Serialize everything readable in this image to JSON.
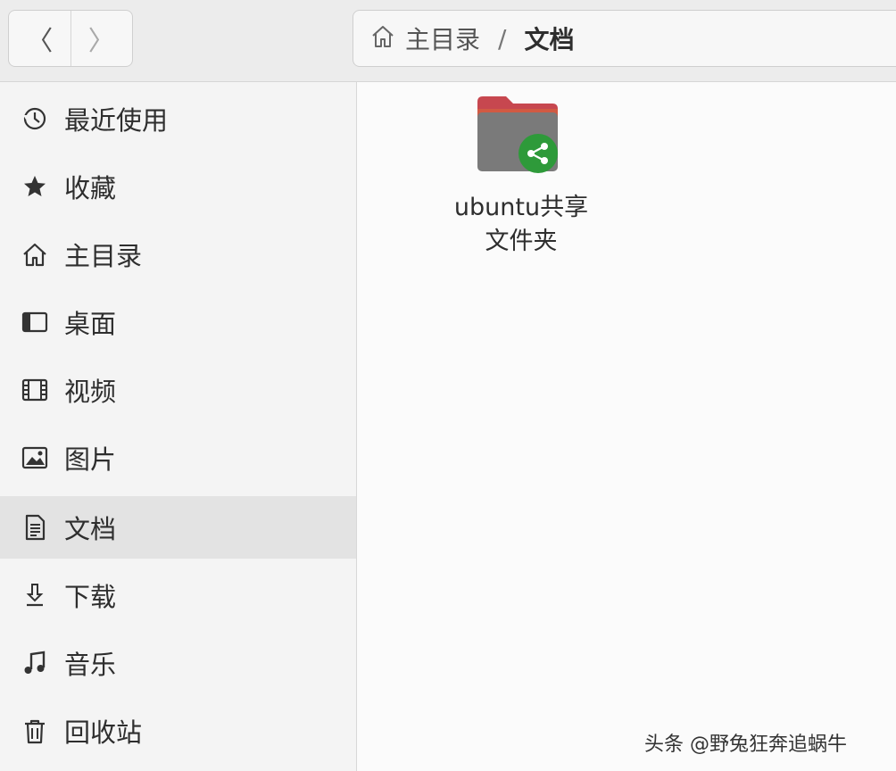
{
  "header": {
    "back_glyph": "〈",
    "forward_glyph": "〉",
    "path": {
      "home": "主目录",
      "separator": "/",
      "current": "文档"
    }
  },
  "sidebar": {
    "items": [
      {
        "label": "最近使用",
        "icon": "recent-icon",
        "active": false
      },
      {
        "label": "收藏",
        "icon": "star-icon",
        "active": false
      },
      {
        "label": "主目录",
        "icon": "home-icon",
        "active": false
      },
      {
        "label": "桌面",
        "icon": "desktop-icon",
        "active": false
      },
      {
        "label": "视频",
        "icon": "video-icon",
        "active": false
      },
      {
        "label": "图片",
        "icon": "pictures-icon",
        "active": false
      },
      {
        "label": "文档",
        "icon": "documents-icon",
        "active": true
      },
      {
        "label": "下载",
        "icon": "download-icon",
        "active": false
      },
      {
        "label": "音乐",
        "icon": "music-icon",
        "active": false
      },
      {
        "label": "回收站",
        "icon": "trash-icon",
        "active": false
      }
    ]
  },
  "files": [
    {
      "name_line1": "ubuntu共享",
      "name_line2": "文件夹",
      "icon": "shared-folder-icon"
    }
  ],
  "watermark": "头条 @野兔狂奔追蜗牛",
  "colors": {
    "folder_top": "#c7474f",
    "folder_body": "#777777",
    "share_badge": "#2e9a3a"
  }
}
